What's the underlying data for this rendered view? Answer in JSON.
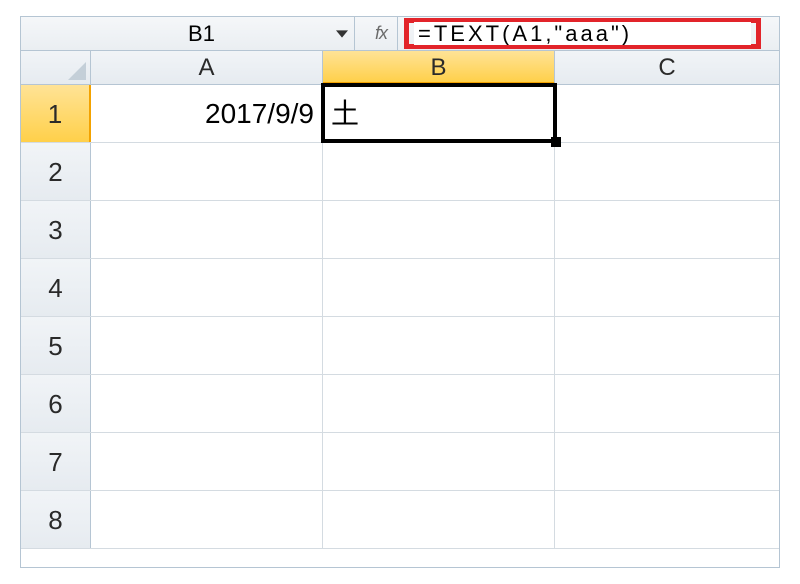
{
  "namebox": {
    "value": "B1"
  },
  "fx_label": "fx",
  "formula": {
    "value": "=TEXT(A1,\"aaa\")"
  },
  "columns": [
    "A",
    "B",
    "C"
  ],
  "selected_column_index": 1,
  "selected_row_index": 0,
  "active_cell": {
    "col": 1,
    "row": 0
  },
  "row_headers": [
    "1",
    "2",
    "3",
    "4",
    "5",
    "6",
    "7",
    "8"
  ],
  "cells": {
    "A1": {
      "value": "2017/9/9",
      "align": "right"
    },
    "B1": {
      "value": "土",
      "align": "left"
    }
  }
}
